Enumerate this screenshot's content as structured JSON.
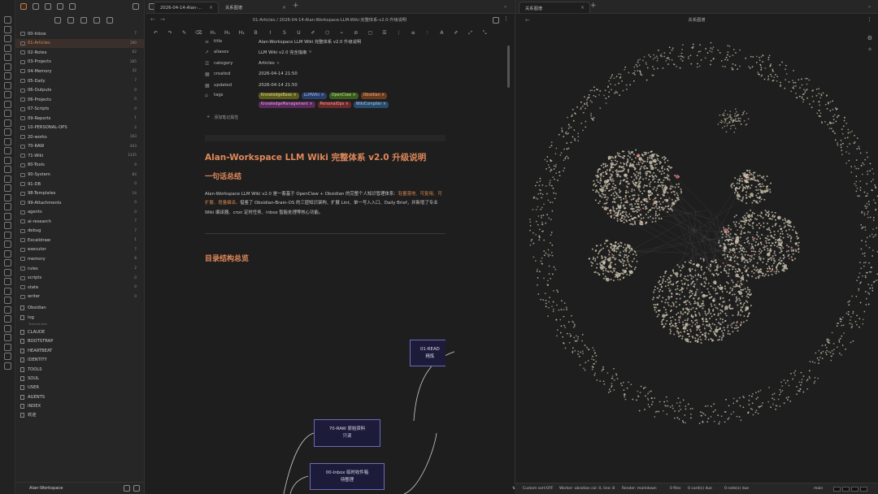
{
  "sidebar": {
    "items": [
      {
        "label": "00-Inbox",
        "count": "7"
      },
      {
        "label": "01-Articles",
        "count": "190"
      },
      {
        "label": "02-Notes",
        "count": "62"
      },
      {
        "label": "03-Projects",
        "count": "185"
      },
      {
        "label": "04-Memory",
        "count": "32"
      },
      {
        "label": "05-Daily",
        "count": "7"
      },
      {
        "label": "06-Outputs",
        "count": "0"
      },
      {
        "label": "06-Projects",
        "count": "0"
      },
      {
        "label": "07-Scripts",
        "count": "0"
      },
      {
        "label": "09-Reports",
        "count": "1"
      },
      {
        "label": "10-PERSONAL-OPS",
        "count": "2"
      },
      {
        "label": "20-works",
        "count": "163"
      },
      {
        "label": "70-RAW",
        "count": "443"
      },
      {
        "label": "71-Wiki",
        "count": "1335"
      },
      {
        "label": "80-Tools",
        "count": "9"
      },
      {
        "label": "90-System",
        "count": "84"
      },
      {
        "label": "91-DB",
        "count": "0"
      },
      {
        "label": "98-Templates",
        "count": "14"
      },
      {
        "label": "99-Attachments",
        "count": "0"
      },
      {
        "label": "agents",
        "count": "0"
      },
      {
        "label": "ai-research",
        "count": "7"
      },
      {
        "label": "debug",
        "count": "7"
      },
      {
        "label": "Excalidraw",
        "count": "1"
      },
      {
        "label": "executor",
        "count": "7"
      },
      {
        "label": "memory",
        "count": "8"
      },
      {
        "label": "rules",
        "count": "2"
      },
      {
        "label": "scripts",
        "count": "0"
      },
      {
        "label": "state",
        "count": "0"
      },
      {
        "label": "writer",
        "count": "0"
      }
    ],
    "files": [
      "Obsidian",
      "log",
      "CLAUDE",
      "BOOTSTRAP",
      "HEARTBEAT",
      "IDENTITY",
      "TOOLS",
      "SOUL",
      "USER",
      "AGENTS",
      "INDEX",
      "欢迎"
    ],
    "log_sub": "Terminal text",
    "vault": "Alan-Workspace"
  },
  "editor": {
    "tab1": "2026-04-14-Alan-...",
    "tab2": "关系图谱",
    "breadcrumb": "01-Articles / 2026-04-14-Alan-Workspace-LLM-Wiki-完整体系-v2.0-升级说明",
    "toolbar": [
      "↶",
      "↷",
      "✎",
      "⌫",
      "H₁",
      "H₂",
      "H₃",
      "B",
      "I",
      "S",
      "U",
      "✐",
      "⬡",
      "⌁",
      "⊘",
      "▢",
      "☰",
      "⋮",
      "≡",
      "⫶",
      "A",
      "✐",
      "⤢",
      "⤡"
    ],
    "props": {
      "title_k": "title",
      "title_v": "Alan-Workspace LLM Wiki 完整体系 v2.0 升级说明",
      "aliases_k": "aliases",
      "aliases_v": "LLM Wiki v2.0 完全指南",
      "category_k": "category",
      "category_v": "Articles",
      "created_k": "created",
      "created_v": "2026-04-14 21:50",
      "updated_k": "updated",
      "updated_v": "2026-04-14 21:50",
      "tags_k": "tags",
      "tags": [
        "KnowledgeBase",
        "LLMWiki",
        "OpenClaw",
        "Obsidian",
        "KnowledgeManagement",
        "PersonalOps",
        "WikiCompiler"
      ],
      "add": "添加笔记属性"
    },
    "h1": "Alan-Workspace LLM Wiki 完整体系 v2.0 升级说明",
    "h2a": "一句话总结",
    "para1": "Alan-Workspace LLM Wiki v2.0 是一套基于 OpenClaw + Obsidian 的完整个人知识管理体系：",
    "para1hl": "轻量落地、可复用、可扩展、增量编译。",
    "para2": "借鉴了 Obsidian-Brain-OS 的三层知识架构、扩展 Lint、单一写入入口、Daily Brief，并新增了专业 Wiki 编译器、cron 定时任务、inbox 智能处理等核心功能。",
    "h2b": "目录结构总览",
    "nodes": {
      "n1": "01-READ\n精炼",
      "n2": "70-RAW 原始资料\n只读",
      "n3": "00-Inbox 临时收件箱\n待整理"
    }
  },
  "graph": {
    "tab": "关系图谱",
    "title": "关系图谱"
  },
  "status": {
    "sort": "Custom sort:OFF",
    "worker": "Worker: obsidian col: 0, line: 8",
    "render": "Render: markdown",
    "files": "0 files",
    "cards": "0 card(s) due",
    "notes": "0 note(s) due",
    "branch": "main"
  },
  "colors": {
    "accent": "#d8874f",
    "bg": "#1e1e1e",
    "node_border": "#6a6ab8"
  }
}
